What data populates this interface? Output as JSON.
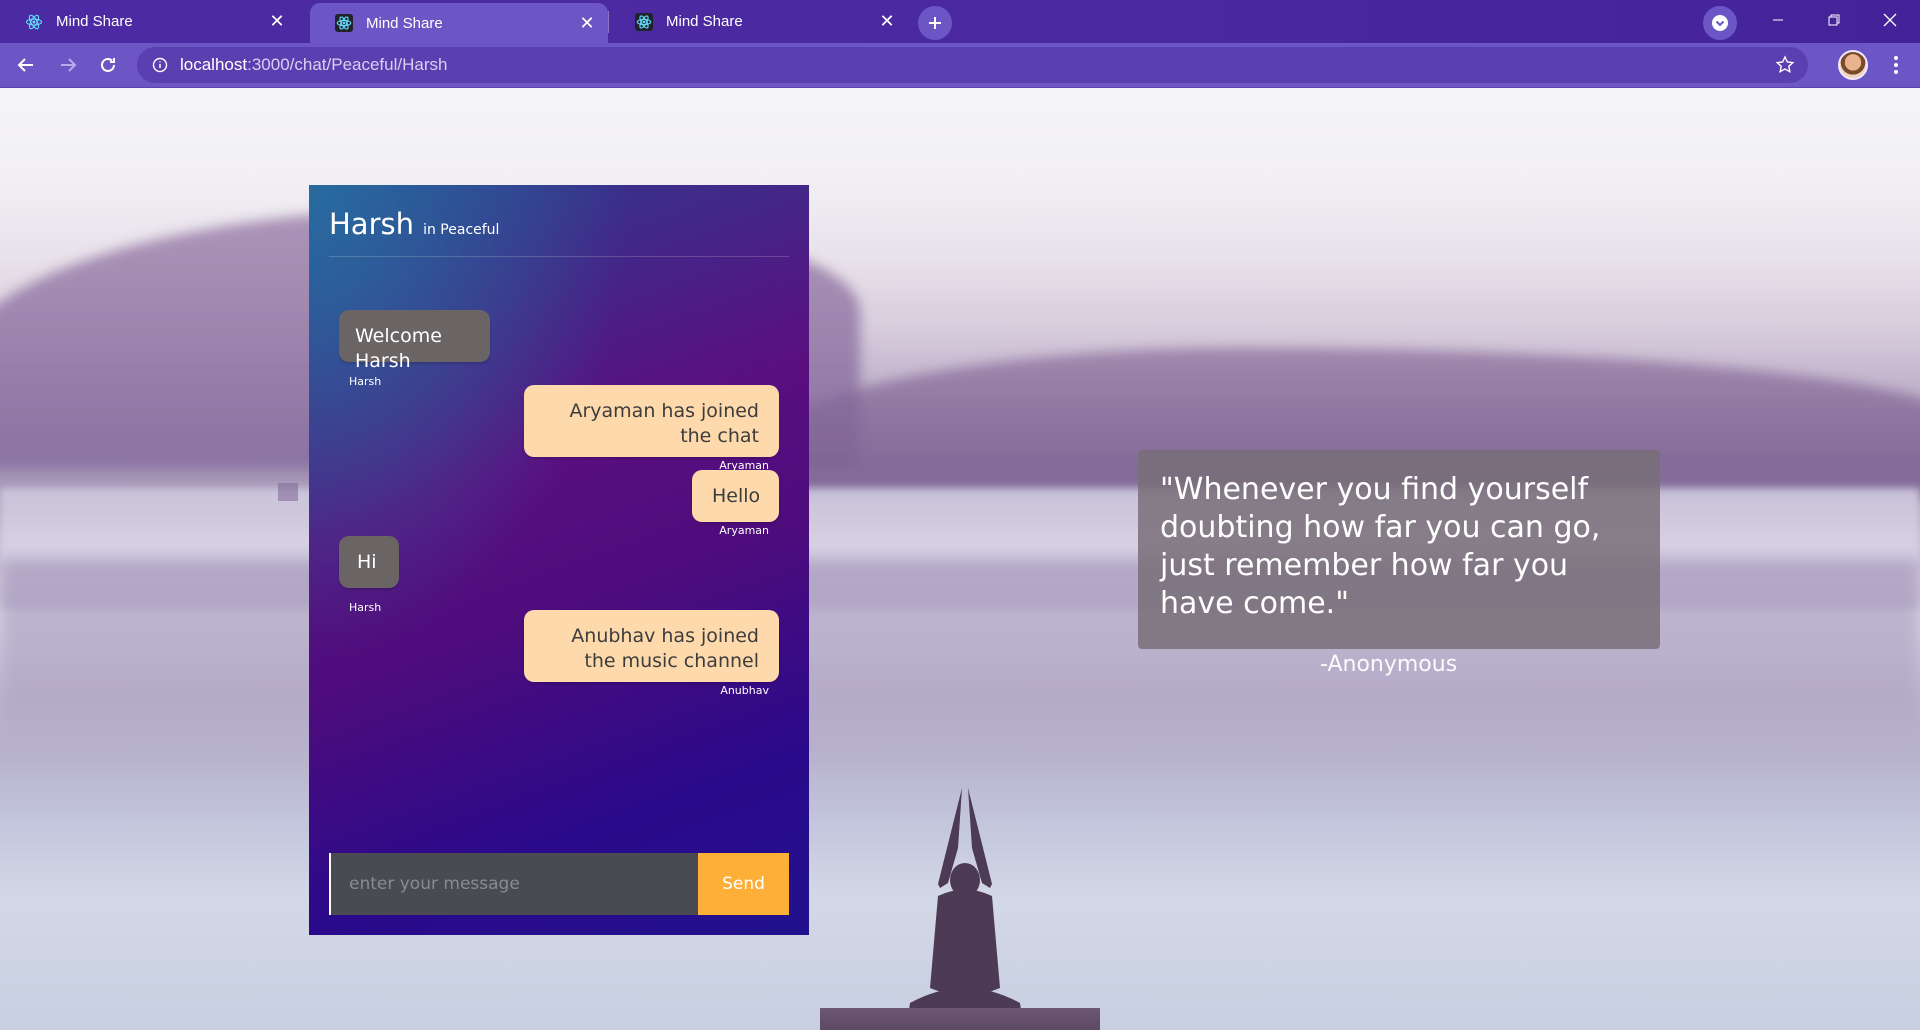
{
  "browser": {
    "tabs": [
      {
        "title": "Mind Share",
        "active": false
      },
      {
        "title": "Mind Share",
        "active": true
      },
      {
        "title": "Mind Share",
        "active": false
      }
    ],
    "url": {
      "host": "localhost",
      "rest": ":3000/chat/Peaceful/Harsh"
    },
    "icons": {
      "favicon": "react-icon",
      "new_tab": "plus-icon",
      "back": "arrow-left-icon",
      "forward": "arrow-right-icon",
      "reload": "reload-icon",
      "info": "info-icon",
      "star": "star-icon",
      "menu": "kebab-menu-icon"
    },
    "accent_color": "#6c55c4"
  },
  "chat": {
    "user": "Harsh",
    "room_label": "in Peaceful",
    "messages": [
      {
        "text": "Welcome Harsh",
        "sender": "Harsh",
        "side": "left"
      },
      {
        "text": "Aryaman has joined the chat",
        "sender": "Aryaman",
        "side": "right"
      },
      {
        "text": "Hello",
        "sender": "Aryaman",
        "side": "right"
      },
      {
        "text": "Hi",
        "sender": "Harsh",
        "side": "left"
      },
      {
        "text": "Anubhav has joined the music channel",
        "sender": "Anubhav",
        "side": "right"
      }
    ],
    "composer": {
      "placeholder": "enter your message",
      "value": "",
      "send_label": "Send"
    },
    "colors": {
      "theirs_bubble": "#6b6464",
      "mine_bubble": "#fdd9ac",
      "send_button": "#fdaf38"
    }
  },
  "quote": {
    "text": "\"Whenever you find yourself doubting how far you can go, just remember how far you have come.\"",
    "author": "-Anonymous"
  }
}
